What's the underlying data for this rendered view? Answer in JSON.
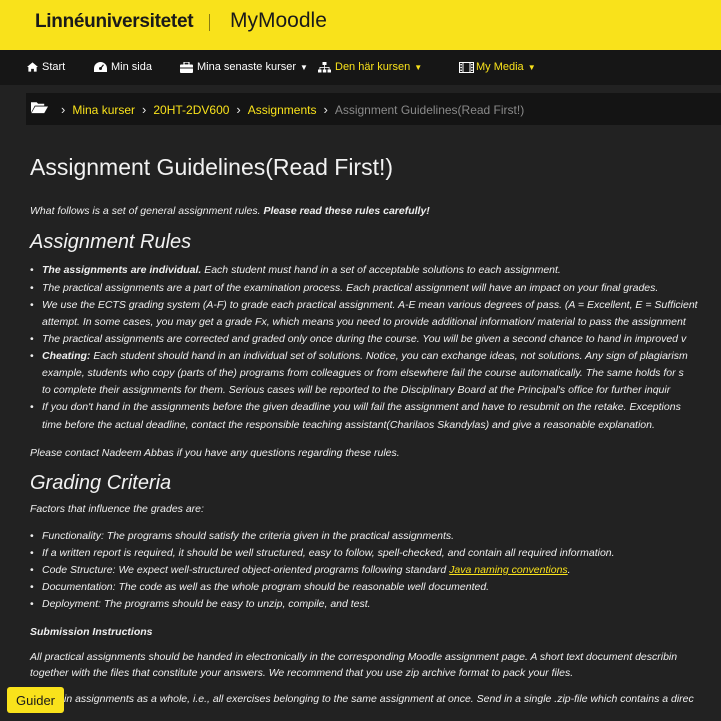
{
  "header": {
    "logo": "Linnéuniversitetet",
    "app_name": "MyMoodle"
  },
  "nav": {
    "start": "Start",
    "my_page": "Min sida",
    "recent_courses": "Mina senaste kurser",
    "this_course": "Den här kursen",
    "my_media": "My Media"
  },
  "breadcrumb": {
    "items": [
      "Mina kurser",
      "20HT-2DV600",
      "Assignments"
    ],
    "current": "Assignment Guidelines(Read First!)"
  },
  "page": {
    "title": "Assignment Guidelines(Read First!)",
    "intro_normal": "What follows is a set of general assignment rules. ",
    "intro_bold": "Please read these rules carefully!",
    "rules_heading": "Assignment Rules",
    "rules": [
      {
        "bold": "The assignments are individual.",
        "text": " Each student must hand in a set of acceptable solutions to each assignment."
      },
      {
        "bold": "",
        "text": "The practical assignments are a part of the examination process. Each practical assignment will have an impact on your final grades."
      },
      {
        "bold": "",
        "text": "We use the ECTS grading system (A-F) to grade each practical assignment. A-E mean various degrees of pass. (A = Excellent, E = Sufficient"
      },
      {
        "bold": "",
        "text": "The practical assignments are corrected and graded only once during the course. You will be given a second chance to hand in improved v"
      },
      {
        "bold": "Cheating:",
        "text": " Each student should hand in an individual set of solutions. Notice, you can exchange ideas, not solutions. Any sign of plagiarism"
      },
      {
        "bold": "",
        "text": "If you don't hand in the assignments before the given deadline you will fail the assignment and have to  resubmit on the retake. Exceptions"
      }
    ],
    "rules_cont": {
      "grading": "attempt. In some cases, you may get a grade Fx, which means you need to provide additional information/ material to pass the assignment",
      "cheating_1": "example, students who copy (parts of the) programs from colleagues or from elsewhere fail the course automatically. The same holds for s",
      "cheating_2": "to complete their assignments for them. Serious cases will be reported to the Disciplinary Board at the Principal's office for further inquir",
      "deadline": "time before the actual deadline, contact the responsible teaching assistant(Charilaos Skandylas) and give a reasonable explanation."
    },
    "contact": "Please contact Nadeem Abbas if you have any questions regarding these rules.",
    "grading_heading": "Grading Criteria",
    "grading_intro": "Factors that influence the grades are:",
    "criteria": [
      "Functionality: The programs should satisfy the criteria given in the practical assignments.",
      "If a written report is required, it should be well structured, easy to follow, spell-checked, and contain all required information."
    ],
    "code_structure_text": "Code Structure: We expect well-structured object-oriented programs following standard ",
    "code_structure_link": "Java naming conventions",
    "criteria_after": [
      "Documentation: The code as well as the whole program should be reasonable well documented.",
      "Deployment: The programs should be easy to unzip, compile, and test."
    ],
    "submission_heading": "Submission Instructions",
    "submission_1": "All practical assignments should be handed in electronically in the corresponding Moodle assignment page. A short text document describin",
    "submission_2": "together with the files that constitute your answers. We recommend that you use zip archive format to pack your files.",
    "submission_3": " in assignments as a whole, i.e., all exercises belonging to the same assignment at once. Send in a single .zip-file which contains a direc"
  },
  "guider_label": "Guider",
  "colors": {
    "accent": "#f9e21b",
    "background": "#222222"
  }
}
